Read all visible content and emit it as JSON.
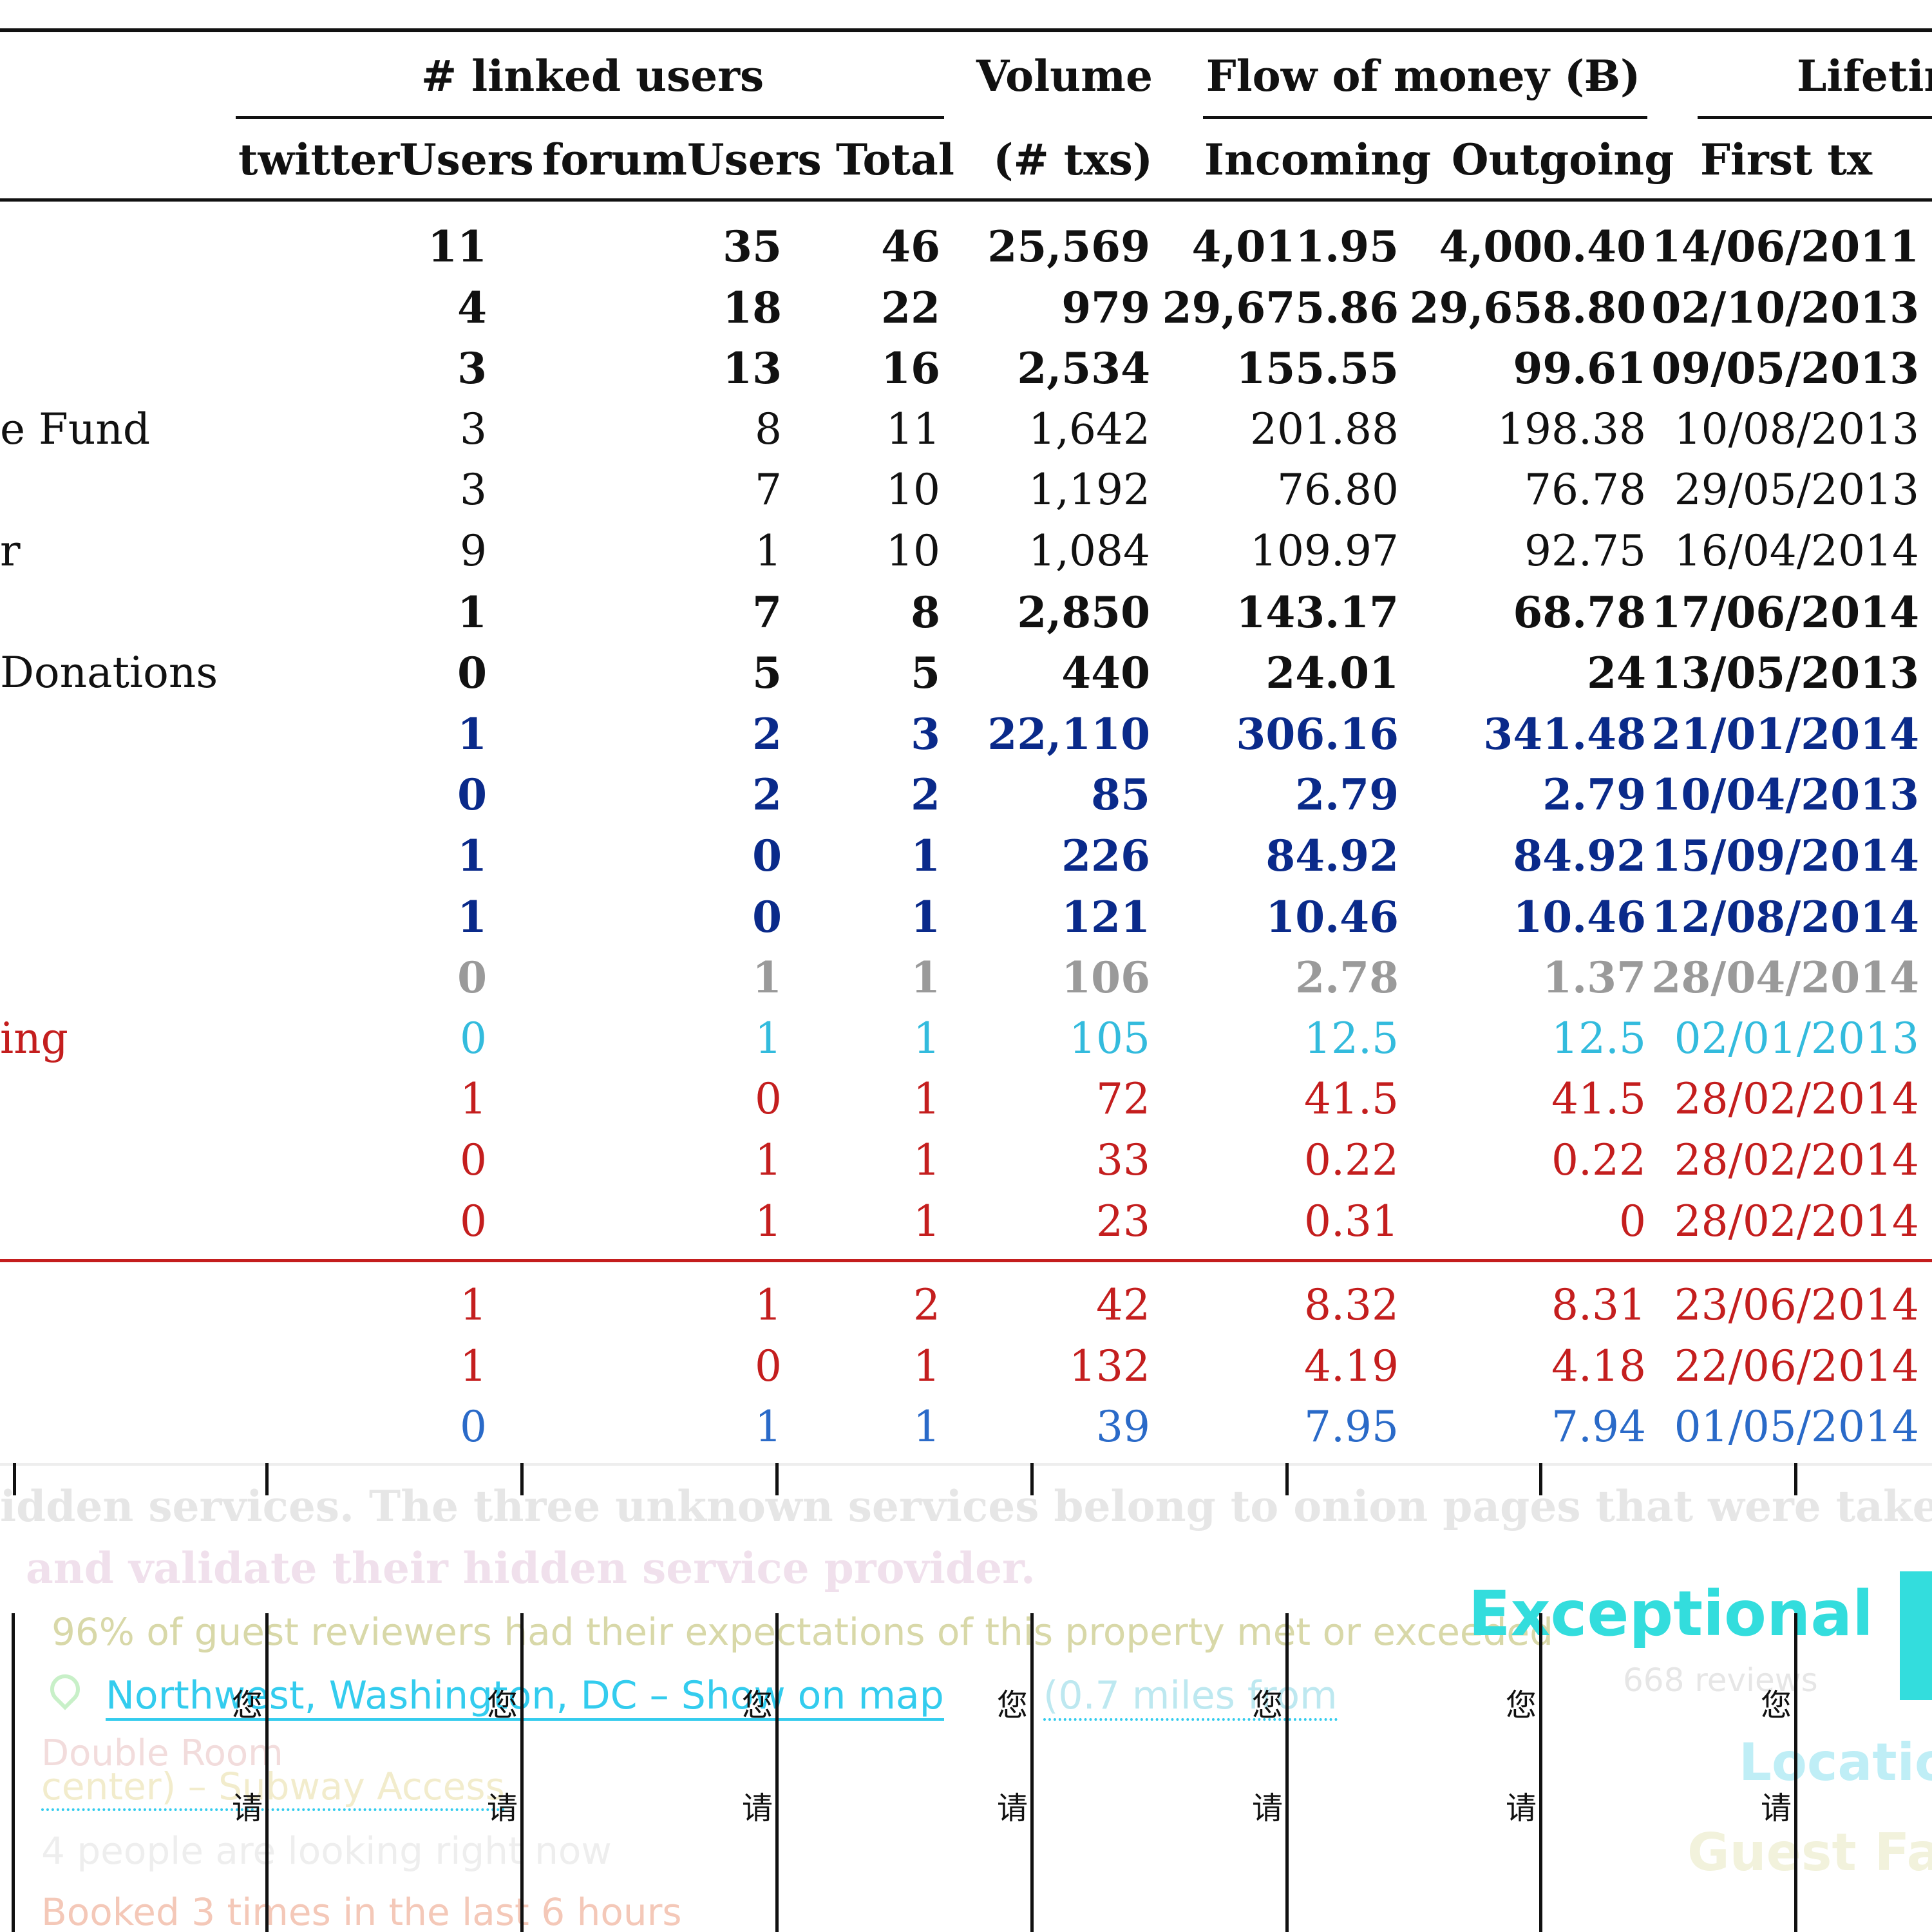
{
  "table": {
    "headers": {
      "linked_users": "# linked users",
      "volume": "Volume",
      "flow_of_money": "Flow of money (Ƀ)",
      "lifetime": "Lifetim",
      "twitter_users": "twitterUsers",
      "forum_users": "forumUsers",
      "total": "Total",
      "txs": "(# txs)",
      "incoming": "Incoming",
      "outgoing": "Outgoing",
      "first_tx": "First tx"
    },
    "rows": [
      {
        "name": "",
        "twitter": "11",
        "forum": "35",
        "total": "46",
        "volume": "25,569",
        "incoming": "4,011.95",
        "outgoing": "4,000.40",
        "first_tx": "14/06/2011"
      },
      {
        "name": "",
        "twitter": "4",
        "forum": "18",
        "total": "22",
        "volume": "979",
        "incoming": "29,675.86",
        "outgoing": "29,658.80",
        "first_tx": "02/10/2013"
      },
      {
        "name": "",
        "twitter": "3",
        "forum": "13",
        "total": "16",
        "volume": "2,534",
        "incoming": "155.55",
        "outgoing": "99.61",
        "first_tx": "09/05/2013"
      },
      {
        "name": "e Fund",
        "twitter": "3",
        "forum": "8",
        "total": "11",
        "volume": "1,642",
        "incoming": "201.88",
        "outgoing": "198.38",
        "first_tx": "10/08/2013"
      },
      {
        "name": "",
        "twitter": "3",
        "forum": "7",
        "total": "10",
        "volume": "1,192",
        "incoming": "76.80",
        "outgoing": "76.78",
        "first_tx": "29/05/2013"
      },
      {
        "name": "r",
        "twitter": "9",
        "forum": "1",
        "total": "10",
        "volume": "1,084",
        "incoming": "109.97",
        "outgoing": "92.75",
        "first_tx": "16/04/2014"
      },
      {
        "name": "",
        "twitter": "1",
        "forum": "7",
        "total": "8",
        "volume": "2,850",
        "incoming": "143.17",
        "outgoing": "68.78",
        "first_tx": "17/06/2014"
      },
      {
        "name": "Donations",
        "twitter": "0",
        "forum": "5",
        "total": "5",
        "volume": "440",
        "incoming": "24.01",
        "outgoing": "24",
        "first_tx": "13/05/2013"
      },
      {
        "name": "",
        "twitter": "1",
        "forum": "2",
        "total": "3",
        "volume": "22,110",
        "incoming": "306.16",
        "outgoing": "341.48",
        "first_tx": "21/01/2014"
      },
      {
        "name": "",
        "twitter": "0",
        "forum": "2",
        "total": "2",
        "volume": "85",
        "incoming": "2.79",
        "outgoing": "2.79",
        "first_tx": "10/04/2013"
      },
      {
        "name": "",
        "twitter": "1",
        "forum": "0",
        "total": "1",
        "volume": "226",
        "incoming": "84.92",
        "outgoing": "84.92",
        "first_tx": "15/09/2014"
      },
      {
        "name": "",
        "twitter": "1",
        "forum": "0",
        "total": "1",
        "volume": "121",
        "incoming": "10.46",
        "outgoing": "10.46",
        "first_tx": "12/08/2014"
      },
      {
        "name": "",
        "twitter": "0",
        "forum": "1",
        "total": "1",
        "volume": "106",
        "incoming": "2.78",
        "outgoing": "1.37",
        "first_tx": "28/04/2014"
      },
      {
        "name": "ing",
        "twitter": "0",
        "forum": "1",
        "total": "1",
        "volume": "105",
        "incoming": "12.5",
        "outgoing": "12.5",
        "first_tx": "02/01/2013"
      },
      {
        "name": "",
        "twitter": "1",
        "forum": "0",
        "total": "1",
        "volume": "72",
        "incoming": "41.5",
        "outgoing": "41.5",
        "first_tx": "28/02/2014"
      },
      {
        "name": "",
        "twitter": "0",
        "forum": "1",
        "total": "1",
        "volume": "33",
        "incoming": "0.22",
        "outgoing": "0.22",
        "first_tx": "28/02/2014"
      },
      {
        "name": "",
        "twitter": "0",
        "forum": "1",
        "total": "1",
        "volume": "23",
        "incoming": "0.31",
        "outgoing": "0",
        "first_tx": "28/02/2014"
      },
      {
        "name": "",
        "twitter": "1",
        "forum": "1",
        "total": "2",
        "volume": "42",
        "incoming": "8.32",
        "outgoing": "8.31",
        "first_tx": "23/06/2014"
      },
      {
        "name": "",
        "twitter": "1",
        "forum": "0",
        "total": "1",
        "volume": "132",
        "incoming": "4.19",
        "outgoing": "4.18",
        "first_tx": "22/06/2014"
      },
      {
        "name": "",
        "twitter": "0",
        "forum": "1",
        "total": "1",
        "volume": "39",
        "incoming": "7.95",
        "outgoing": "7.94",
        "first_tx": "01/05/2014"
      }
    ]
  },
  "caption_fragment": {
    "line1": "idden services. The three unknown services belong to onion pages that were taken d",
    "line2": "and validate their hidden service provider."
  },
  "web_fragment": {
    "expectations": "96% of guest reviewers had their expectations of this property met or exceeded",
    "exceptional": "Exceptional",
    "reviews": "668 reviews",
    "location_link": "Northwest, Washington, DC – Show on map",
    "distance": "(0.7 miles from",
    "room": "Double Room",
    "center": "center) – Subway Access",
    "looking": "4 people are looking right now",
    "booked": "Booked 3 times in the last 6 hours",
    "location_label": "Location",
    "guest_fav": "Guest Fav",
    "cjk_nin": "您",
    "cjk_qing": "请"
  },
  "colors": {
    "navy": "#0a2a8a",
    "red": "#c41e1e",
    "cyan": "#33dddd",
    "link": "#33ccee"
  }
}
